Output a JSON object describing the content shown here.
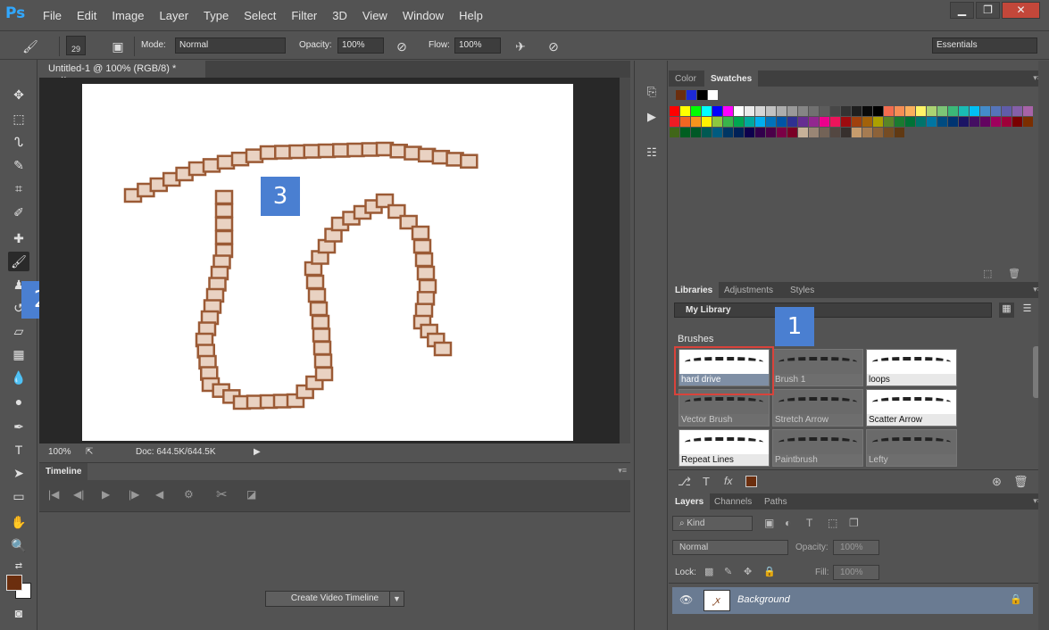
{
  "app": {
    "logo": "Ps"
  },
  "menu": [
    "File",
    "Edit",
    "Image",
    "Layer",
    "Type",
    "Select",
    "Filter",
    "3D",
    "View",
    "Window",
    "Help"
  ],
  "window_controls": {
    "minimize": "▁",
    "restore": "❐",
    "close": "✕"
  },
  "options": {
    "brush_size": "29",
    "mode_label": "Mode:",
    "mode_value": "Normal",
    "opacity_label": "Opacity:",
    "opacity_value": "100%",
    "flow_label": "Flow:",
    "flow_value": "100%",
    "workspace": "Essentials"
  },
  "document": {
    "tab_title": "Untitled-1 @ 100% (RGB/8) *",
    "tab_close": "×",
    "zoom": "100%",
    "doc_info": "Doc: 644.5K/644.5K"
  },
  "timeline": {
    "tab": "Timeline",
    "create_button": "Create Video Timeline"
  },
  "swatches_panel": {
    "tabs": [
      "Color",
      "Swatches"
    ],
    "recent_colors": [
      "#6b2e0e",
      "#1d2ad4",
      "#000000",
      "#ffffff"
    ]
  },
  "libraries_panel": {
    "tabs": [
      "Libraries",
      "Adjustments",
      "Styles"
    ],
    "library": "My Library",
    "section": "Brushes",
    "brushes": [
      {
        "name": "hard drive",
        "selected": true
      },
      {
        "name": "Brush 1"
      },
      {
        "name": "loops"
      },
      {
        "name": "Vector Brush"
      },
      {
        "name": "Stretch Arrow"
      },
      {
        "name": "Scatter Arrow"
      },
      {
        "name": "Repeat Lines"
      },
      {
        "name": "Paintbrush"
      },
      {
        "name": "Lefty"
      }
    ]
  },
  "layers_panel": {
    "tabs": [
      "Layers",
      "Channels",
      "Paths"
    ],
    "filter_kind": "Kind",
    "blend_mode": "Normal",
    "opacity_label": "Opacity:",
    "opacity_value": "100%",
    "lock_label": "Lock:",
    "fill_label": "Fill:",
    "fill_value": "100%",
    "layer_name": "Background"
  },
  "callouts": {
    "one": "1",
    "two": "2",
    "three": "3"
  },
  "colors": {
    "foreground": "#6b2e0e",
    "background": "#ffffff",
    "stroke": "#9b5a35",
    "accent": "#4a7fd1"
  }
}
